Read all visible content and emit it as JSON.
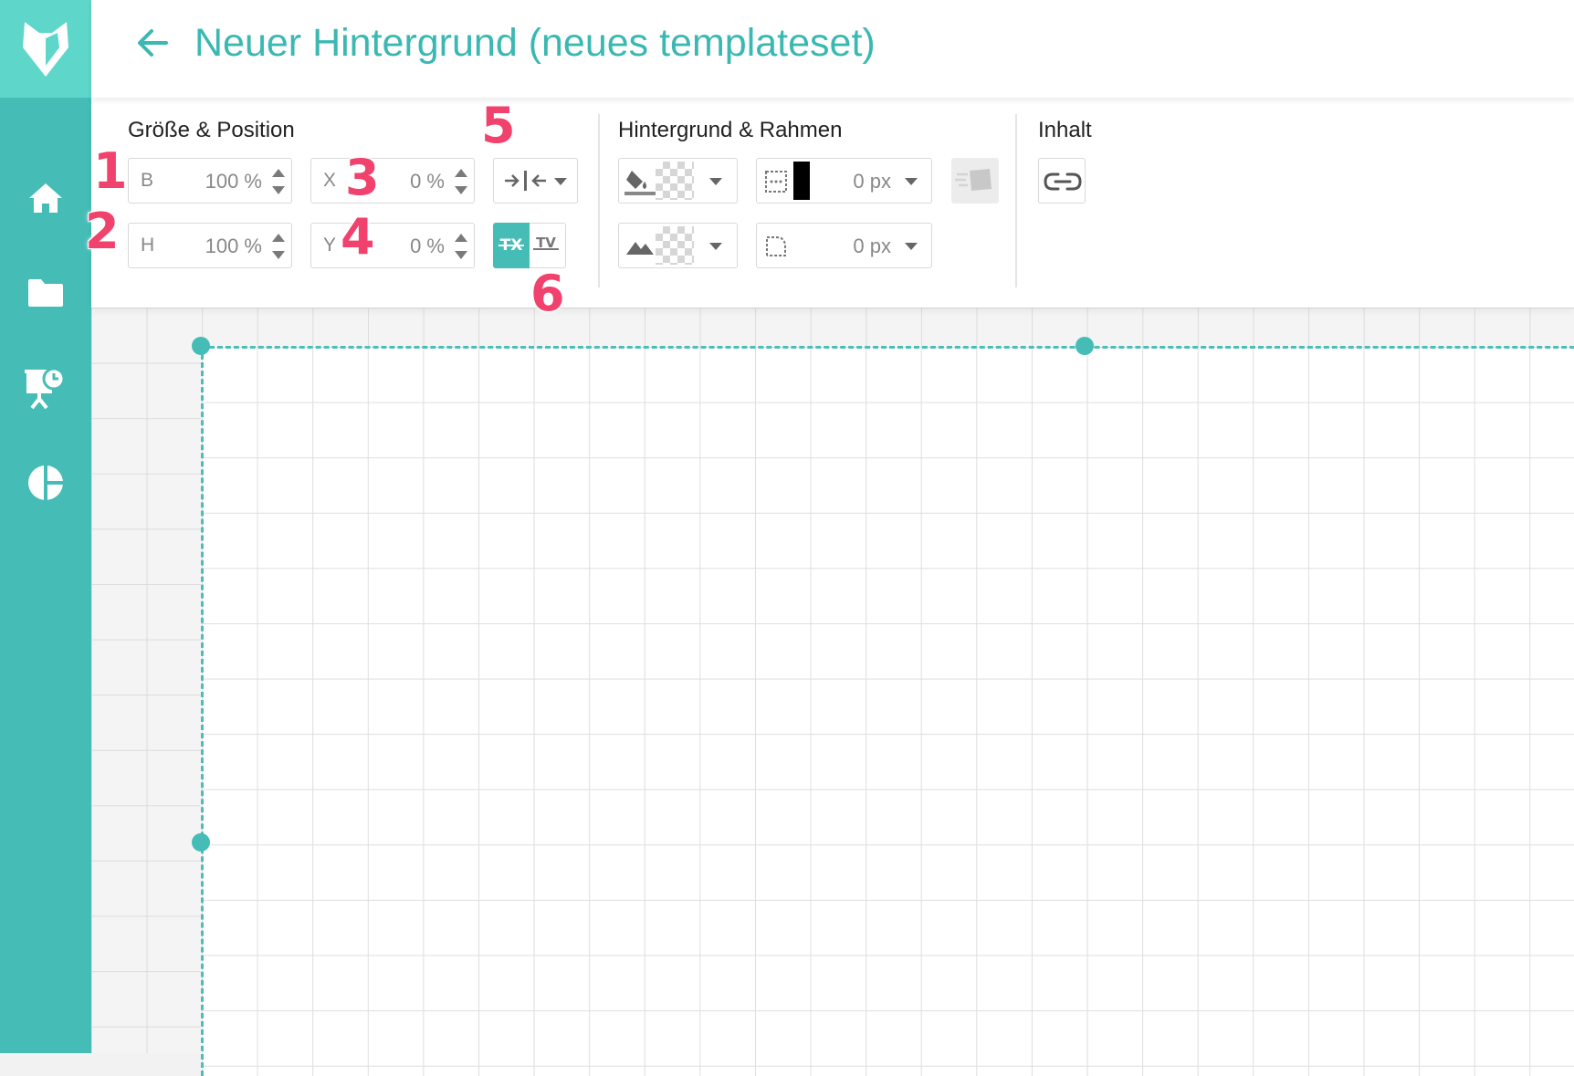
{
  "header": {
    "title": "Neuer Hintergrund (neues templateset)"
  },
  "sidebar": {
    "items": [
      "home-icon",
      "folder-icon",
      "presentation-icon",
      "analytics-icon"
    ]
  },
  "size_position": {
    "label": "Größe & Position",
    "width": {
      "label": "B",
      "value": "100 %"
    },
    "height": {
      "label": "H",
      "value": "100 %"
    },
    "x": {
      "label": "X",
      "value": "0 %"
    },
    "y": {
      "label": "Y",
      "value": "0 %"
    }
  },
  "background_border": {
    "label": "Hintergrund & Rahmen",
    "border_width": "0 px",
    "radius": "0 px",
    "border_color": "#000000"
  },
  "content": {
    "label": "Inhalt"
  },
  "badges": [
    "1",
    "2",
    "3",
    "4",
    "5",
    "6"
  ],
  "colors": {
    "accent": "#45bdb6",
    "accent_light": "#5fd6ca",
    "badge": "#f0426c"
  }
}
